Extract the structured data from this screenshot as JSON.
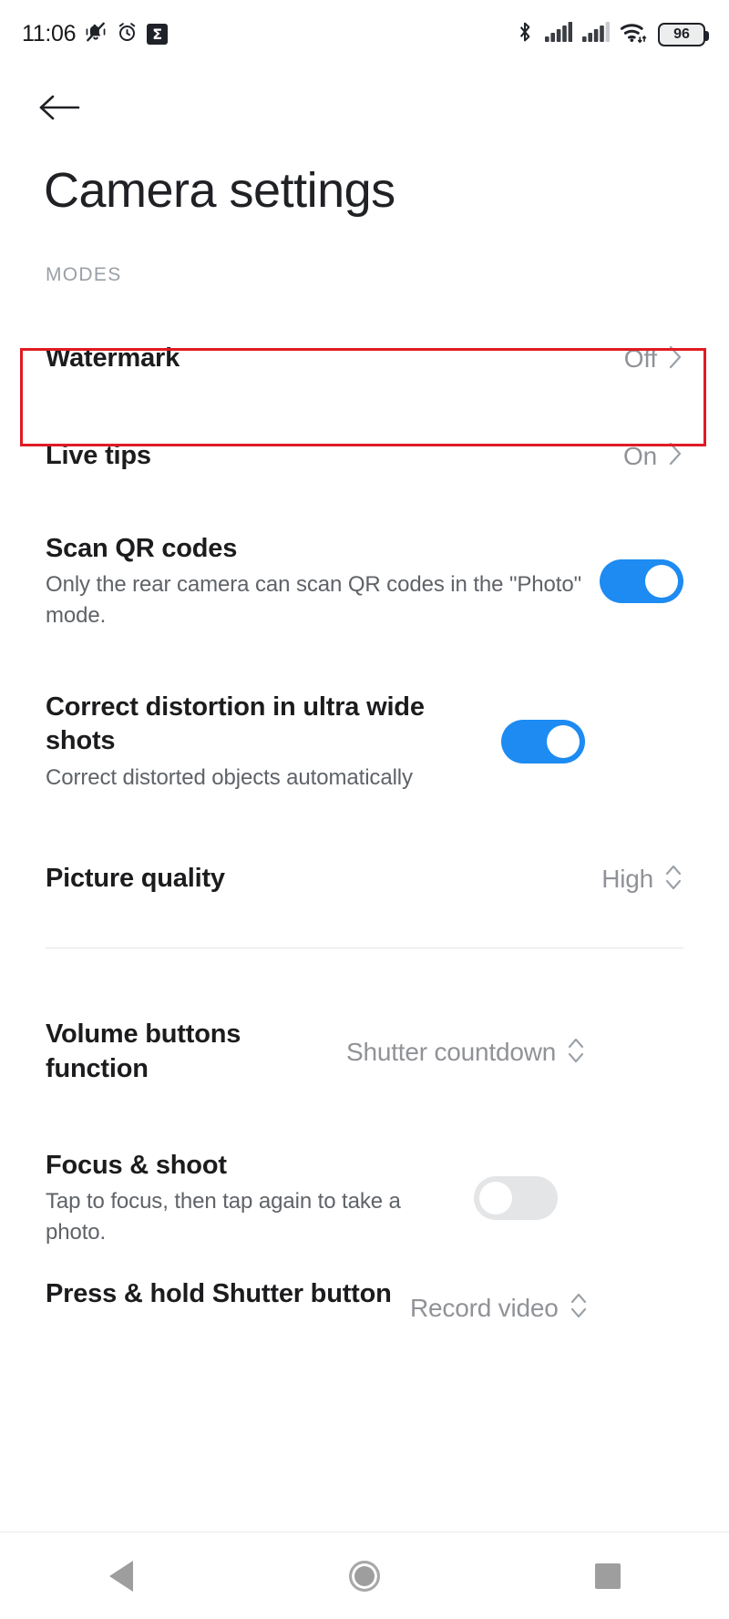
{
  "status_bar": {
    "time": "11:06",
    "left_icons": [
      "mute-vibrate-icon",
      "alarm-clock-icon",
      "sigma-app-icon"
    ],
    "sigma_glyph": "Σ",
    "right_icons": [
      "bluetooth-icon",
      "signal-sim1-icon",
      "signal-sim2-icon",
      "wifi-icon"
    ],
    "battery_level": "96"
  },
  "header": {
    "back_label": "Back",
    "title": "Camera settings"
  },
  "section": {
    "modes_label": "MODES"
  },
  "colors": {
    "toggle_on": "#1d8bf1",
    "toggle_off": "#e3e5e7",
    "highlight": "#e01b24",
    "title_text": "#202124",
    "secondary_text": "#5f6368",
    "value_text": "#909297"
  },
  "rows": [
    {
      "name": "watermark",
      "title": "Watermark",
      "subtitle": "",
      "value": "Off",
      "control": "chevron",
      "highlighted": true
    },
    {
      "name": "live-tips",
      "title": "Live tips",
      "subtitle": "",
      "value": "On",
      "control": "chevron",
      "highlighted": false
    },
    {
      "name": "scan-qr-codes",
      "title": "Scan QR codes",
      "subtitle": "Only the rear camera can scan QR codes in the \"Photo\" mode.",
      "value": "",
      "control": "toggle",
      "toggle_state": "on",
      "highlighted": false
    },
    {
      "name": "correct-distortion",
      "title": "Correct distortion in ultra wide shots",
      "subtitle": "Correct distorted objects automatically",
      "value": "",
      "control": "toggle",
      "toggle_state": "on",
      "highlighted": false
    },
    {
      "name": "picture-quality",
      "title": "Picture quality",
      "subtitle": "",
      "value": "High",
      "control": "stepper",
      "highlighted": false
    },
    {
      "name": "volume-buttons-function",
      "title": "Volume buttons function",
      "subtitle": "",
      "value": "Shutter countdown",
      "control": "stepper",
      "highlighted": false
    },
    {
      "name": "focus-and-shoot",
      "title": "Focus & shoot",
      "subtitle": "Tap to focus, then tap again to take a photo.",
      "value": "",
      "control": "toggle",
      "toggle_state": "off",
      "highlighted": false
    },
    {
      "name": "press-hold-shutter-button",
      "title": "Press & hold Shutter button",
      "subtitle": "",
      "value": "Record video",
      "control": "stepper",
      "highlighted": false
    }
  ],
  "nav_bar": {
    "back": "back-triangle-icon",
    "home": "home-circle-icon",
    "recents": "recents-square-icon"
  }
}
